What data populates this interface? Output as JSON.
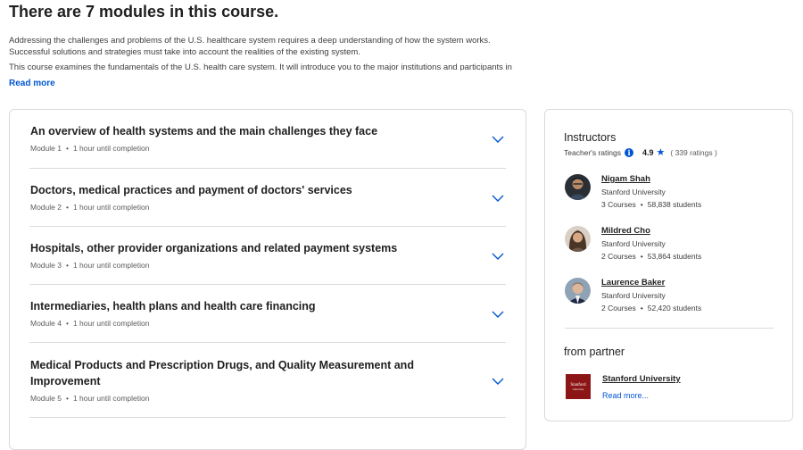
{
  "page": {
    "title": "There are 7 modules in this course.",
    "description": [
      "Addressing the challenges and problems of the U.S. healthcare system requires a deep understanding of how the system works. Successful solutions and strategies must take into account the realities of the existing system.",
      "This course examines the fundamentals of the U.S. health care system. It will introduce you to the major institutions and participants in"
    ],
    "read_more": "Read more"
  },
  "modules": [
    {
      "title": "An overview of health systems and the main challenges they face",
      "number": "Module 1",
      "duration": "1 hour until completion"
    },
    {
      "title": "Doctors, medical practices and payment of doctors' services",
      "number": "Module 2",
      "duration": "1 hour until completion"
    },
    {
      "title": "Hospitals, other provider organizations and related payment systems",
      "number": "Module 3",
      "duration": "1 hour until completion"
    },
    {
      "title": "Intermediaries, health plans and health care financing",
      "number": "Module 4",
      "duration": "1 hour until completion"
    },
    {
      "title": "Medical Products and Prescription Drugs, and Quality Measurement and Improvement",
      "number": "Module 5",
      "duration": "1 hour until completion"
    }
  ],
  "meta_separator": "•",
  "instructors": {
    "heading": "Instructors",
    "ratings_label": "Teacher's ratings",
    "rating_value": "4.9",
    "rating_count": "( 339 ratings )",
    "star_icon": "star-icon",
    "info_icon": "info-icon",
    "people": [
      {
        "name": "Nigam Shah",
        "org": "Stanford University",
        "courses": "3 Courses",
        "students": "58,838 students"
      },
      {
        "name": "Mildred Cho",
        "org": "Stanford University",
        "courses": "2 Courses",
        "students": "53,864 students"
      },
      {
        "name": "Laurence Baker",
        "org": "Stanford University",
        "courses": "2 Courses",
        "students": "52,420 students"
      }
    ]
  },
  "partner": {
    "heading": "from partner",
    "name": "Stanford University",
    "read_more": "Read more...",
    "logo_text": "Stanford",
    "logo_subtext": "University"
  },
  "colors": {
    "accent": "#0056d2",
    "partner_brand": "#8c1515",
    "border": "#dadada"
  }
}
